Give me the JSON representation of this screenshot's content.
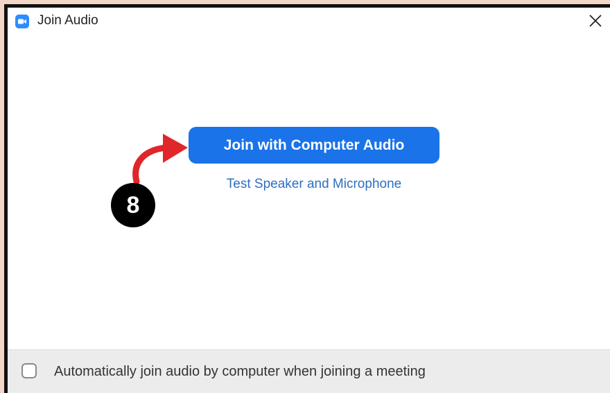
{
  "window": {
    "title": "Join Audio",
    "app_icon": "zoom-camera-icon",
    "close_icon": "close-icon"
  },
  "main": {
    "join_button_label": "Join with Computer Audio",
    "test_link_label": "Test Speaker and Microphone"
  },
  "annotation": {
    "step_number": "8",
    "arrow_icon": "curved-arrow-icon",
    "arrow_color": "#e0262b"
  },
  "footer": {
    "auto_join_label": "Automatically join audio by computer when joining a meeting",
    "auto_join_checked": false
  },
  "colors": {
    "accent": "#1a73e8",
    "link": "#2d6fc2"
  }
}
